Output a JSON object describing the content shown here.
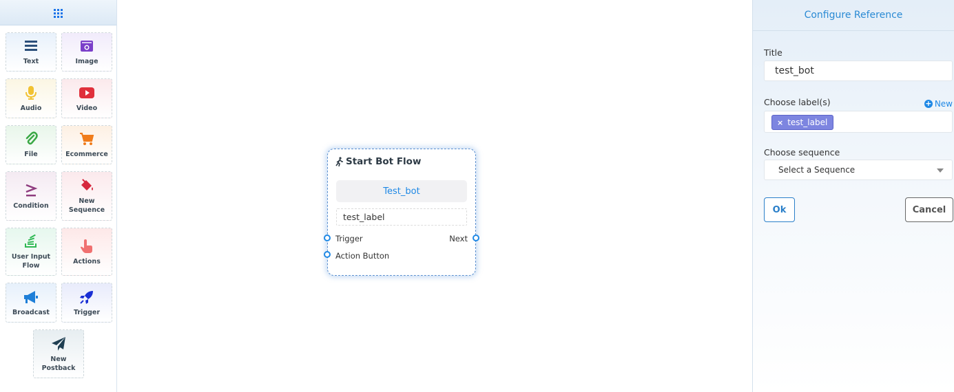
{
  "palette": {
    "items": [
      {
        "label": "Text",
        "icon": "text-lines-icon"
      },
      {
        "label": "Image",
        "icon": "image-icon"
      },
      {
        "label": "Audio",
        "icon": "microphone-icon"
      },
      {
        "label": "Video",
        "icon": "youtube-play-icon"
      },
      {
        "label": "File",
        "icon": "paperclip-icon"
      },
      {
        "label": "Ecommerce",
        "icon": "shopping-cart-icon"
      },
      {
        "label": "Condition",
        "icon": "greater-equal-icon"
      },
      {
        "label": "New Sequence",
        "icon": "paint-bucket-icon"
      },
      {
        "label": "User Input Flow",
        "icon": "stack-icon"
      },
      {
        "label": "Actions",
        "icon": "hand-pointer-icon"
      },
      {
        "label": "Broadcast",
        "icon": "megaphone-icon"
      },
      {
        "label": "Trigger",
        "icon": "rocket-icon"
      },
      {
        "label": "New Postback",
        "icon": "paper-plane-icon"
      }
    ]
  },
  "node": {
    "title": "Start Bot Flow",
    "name": "Test_bot",
    "label": "test_label",
    "ports": {
      "trigger": "Trigger",
      "next": "Next",
      "action_button": "Action Button"
    }
  },
  "panel": {
    "title": "Configure Reference",
    "title_field": {
      "label": "Title",
      "value": "test_bot"
    },
    "labels_field": {
      "label": "Choose label(s)",
      "new_link": "New",
      "tags": [
        "test_label"
      ]
    },
    "sequence_field": {
      "label": "Choose sequence",
      "placeholder": "Select a Sequence"
    },
    "ok_label": "Ok",
    "cancel_label": "Cancel"
  },
  "colors": {
    "accent": "#1e88e5",
    "tag": "#7d85e0"
  }
}
